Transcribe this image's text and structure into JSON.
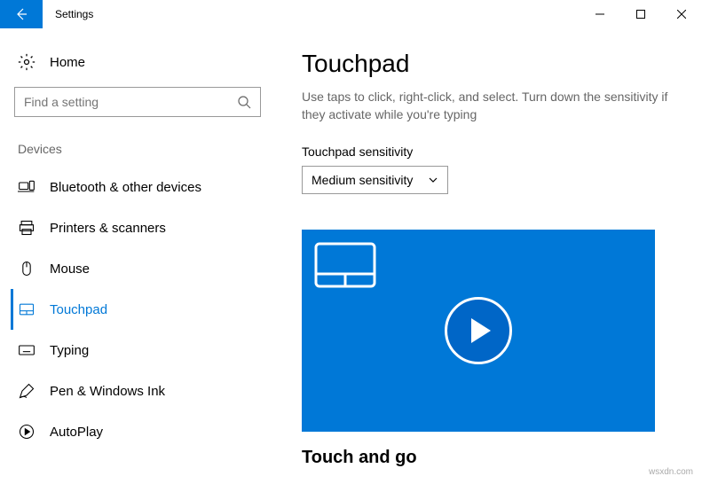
{
  "titlebar": {
    "title": "Settings"
  },
  "sidebar": {
    "home_label": "Home",
    "search_placeholder": "Find a setting",
    "section": "Devices",
    "items": [
      {
        "label": "Bluetooth & other devices"
      },
      {
        "label": "Printers & scanners"
      },
      {
        "label": "Mouse"
      },
      {
        "label": "Touchpad"
      },
      {
        "label": "Typing"
      },
      {
        "label": "Pen & Windows Ink"
      },
      {
        "label": "AutoPlay"
      }
    ]
  },
  "main": {
    "title": "Touchpad",
    "description": "Use taps to click, right-click, and select. Turn down the sensitivity if they activate while you're typing",
    "sensitivity_label": "Touchpad sensitivity",
    "sensitivity_value": "Medium sensitivity",
    "secondary_title": "Touch and go"
  },
  "watermark": "wsxdn.com"
}
